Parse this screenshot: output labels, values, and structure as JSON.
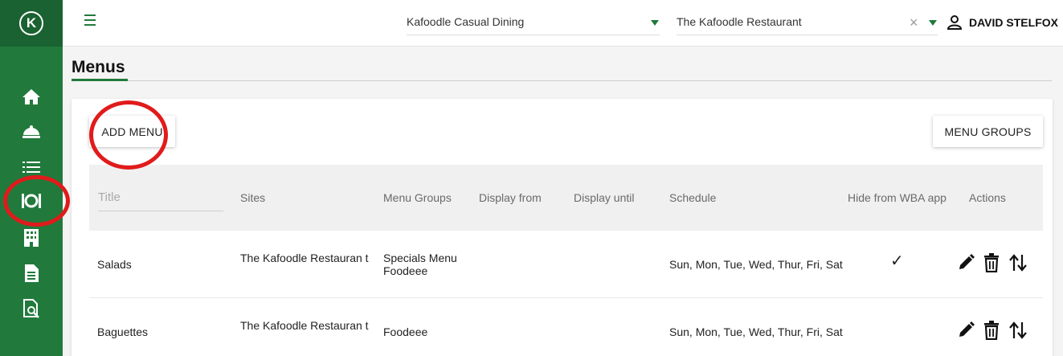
{
  "sidebar": {
    "logo": "K",
    "icons": [
      "home-icon",
      "cloche-icon",
      "list-icon",
      "menu-dining-icon",
      "building-icon",
      "document-icon",
      "report-search-icon"
    ]
  },
  "topbar": {
    "company_select": "Kafoodle Casual Dining",
    "site_select": "The Kafoodle Restaurant",
    "clear_symbol": "×",
    "user_name": "DAVID STELFOX"
  },
  "page": {
    "title": "Menus"
  },
  "toolbar": {
    "add_menu_label": "ADD MENU",
    "menu_groups_label": "MENU GROUPS"
  },
  "table": {
    "title_filter_placeholder": "Title",
    "headers": {
      "sites": "Sites",
      "menu_groups": "Menu Groups",
      "display_from": "Display from",
      "display_until": "Display until",
      "schedule": "Schedule",
      "hide_from_wba": "Hide from WBA app",
      "actions": "Actions"
    },
    "rows": [
      {
        "title": "Salads",
        "sites": "The Kafoodle Restauran t",
        "menu_groups_line1": "Specials Menu",
        "menu_groups_line2": "Foodeee",
        "schedule": "Sun, Mon, Tue, Wed, Thur, Fri, Sat",
        "hide_from_wba": "✓"
      },
      {
        "title": "Baguettes",
        "sites": "The Kafoodle Restauran t",
        "menu_groups_line1": "Foodeee",
        "menu_groups_line2": "",
        "schedule": "Sun, Mon, Tue, Wed, Thur, Fri, Sat",
        "hide_from_wba": ""
      }
    ]
  },
  "annotations": {
    "color": "#e01b1b"
  },
  "colors": {
    "brand_green": "#217a3c",
    "brand_green_dark": "#1a6231"
  }
}
